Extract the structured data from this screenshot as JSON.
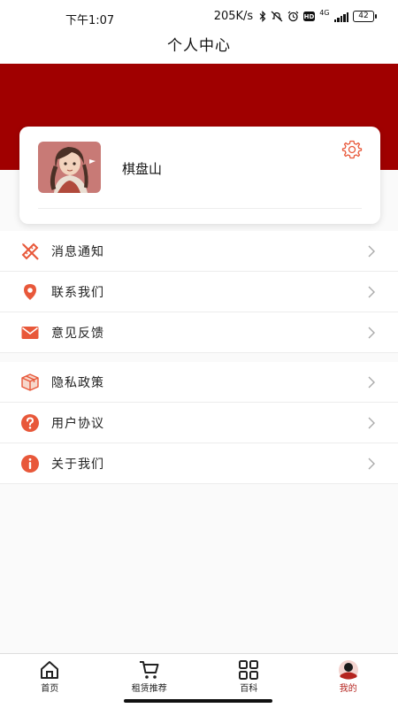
{
  "status_bar": {
    "time": "下午1:07",
    "network_speed": "205K/s",
    "network_type": "4G",
    "battery": "42",
    "icons": [
      "bluetooth-icon",
      "mute-icon",
      "alarm-icon",
      "hd-icon",
      "signal-icon",
      "battery-icon"
    ]
  },
  "header": {
    "title": "个人中心",
    "background_color": "#a00000"
  },
  "profile": {
    "username": "棋盘山",
    "avatar_icon": "avatar",
    "settings_icon": "gear-icon"
  },
  "menu_group_1": [
    {
      "label": "消息通知",
      "icon": "ruler-pencil-icon"
    },
    {
      "label": "联系我们",
      "icon": "location-pin-icon"
    },
    {
      "label": "意见反馈",
      "icon": "mail-icon"
    }
  ],
  "menu_group_2": [
    {
      "label": "隐私政策",
      "icon": "box-icon"
    },
    {
      "label": "用户协议",
      "icon": "question-icon"
    },
    {
      "label": "关于我们",
      "icon": "info-icon"
    }
  ],
  "bottom_nav": {
    "items": [
      {
        "label": "首页",
        "icon": "home-icon"
      },
      {
        "label": "租赁推荐",
        "icon": "cart-icon"
      },
      {
        "label": "百科",
        "icon": "grid-icon"
      },
      {
        "label": "我的",
        "icon": "user-icon",
        "active": true
      }
    ],
    "active_color": "#b4231e"
  },
  "colors": {
    "accent": "#e8583a",
    "header_red": "#a00000"
  }
}
